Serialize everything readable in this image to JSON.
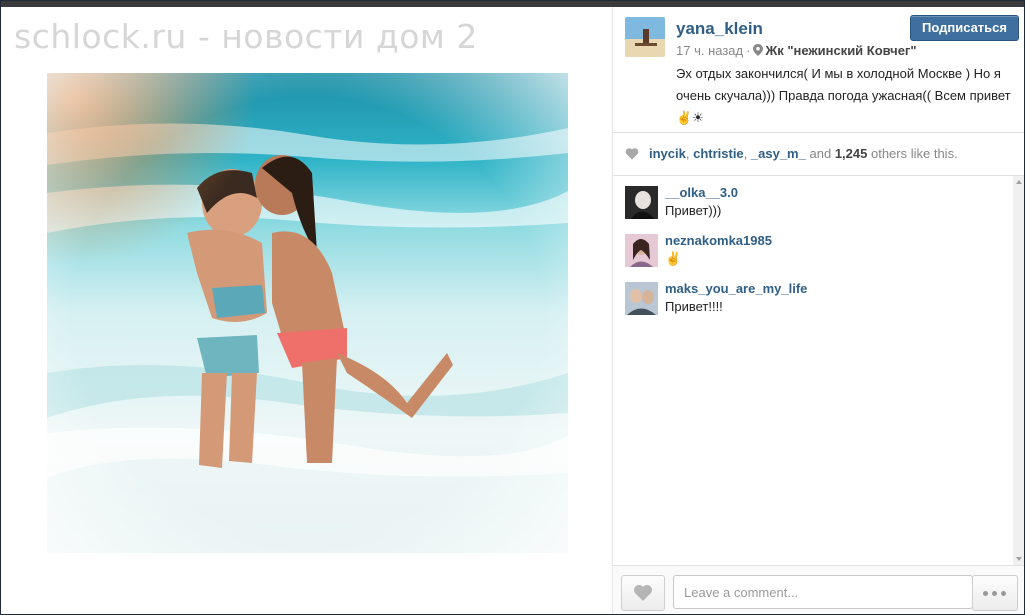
{
  "watermark": "schlock.ru - новости дом 2",
  "post": {
    "username": "yana_klein",
    "follow_label": "Подписаться",
    "time_ago": "17 ч. назад",
    "separator": "·",
    "location": "Жк \"нежинский Ковчег\"",
    "caption": "Эх отдых закончился( И мы в холодной Москве ) Но я очень скучала))) Правда погода ужасная(( Всем привет✌️☀",
    "icons": {
      "location": "map-pin-icon",
      "like": "heart-icon",
      "more": "ellipsis-icon"
    }
  },
  "likes": {
    "users": [
      "inycik",
      "chtristie",
      "_asy_m_"
    ],
    "connector": "and",
    "count": "1,245",
    "suffix": "others like this."
  },
  "comments": [
    {
      "user": "__olka__3.0",
      "text": "Привет)))"
    },
    {
      "user": "neznakomka1985",
      "text": "✌"
    },
    {
      "user": "maks_you_are_my_life",
      "text": "Привет!!!!"
    }
  ],
  "footer": {
    "comment_placeholder": "Leave a comment..."
  },
  "colors": {
    "link": "#2f5f87",
    "button": "#3f6f9e",
    "watermark": "#d6d6d6"
  }
}
